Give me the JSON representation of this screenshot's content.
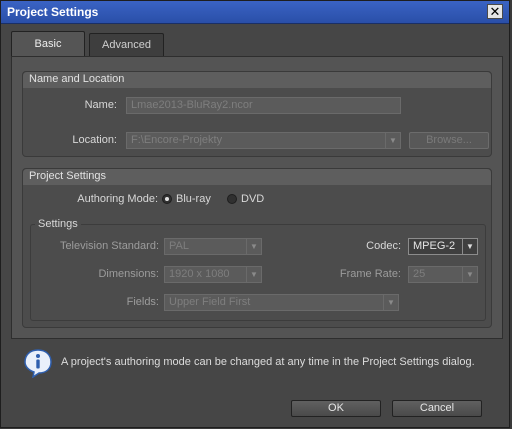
{
  "window": {
    "title": "Project Settings",
    "close_glyph": "✕"
  },
  "tabs": [
    {
      "label": "Basic"
    },
    {
      "label": "Advanced"
    }
  ],
  "name_location": {
    "title": "Name and Location",
    "name_label": "Name:",
    "name_value": "Lmae2013-BluRay2.ncor",
    "location_label": "Location:",
    "location_value": "F:\\Encore-Projekty",
    "browse_label": "Browse..."
  },
  "project_settings": {
    "title": "Project Settings",
    "authoring_label": "Authoring Mode:",
    "bluray_label": "Blu-ray",
    "dvd_label": "DVD",
    "settings_legend": "Settings",
    "tv_standard_label": "Television Standard:",
    "tv_standard_value": "PAL",
    "codec_label": "Codec:",
    "codec_value": "MPEG-2",
    "dimensions_label": "Dimensions:",
    "dimensions_value": "1920 x 1080",
    "frame_rate_label": "Frame Rate:",
    "frame_rate_value": "25",
    "fields_label": "Fields:",
    "fields_value": "Upper Field First"
  },
  "info": {
    "icon": "info-icon",
    "text": "A project's authoring mode can be changed at any time in the Project Settings dialog."
  },
  "buttons": {
    "ok": "OK",
    "cancel": "Cancel"
  }
}
